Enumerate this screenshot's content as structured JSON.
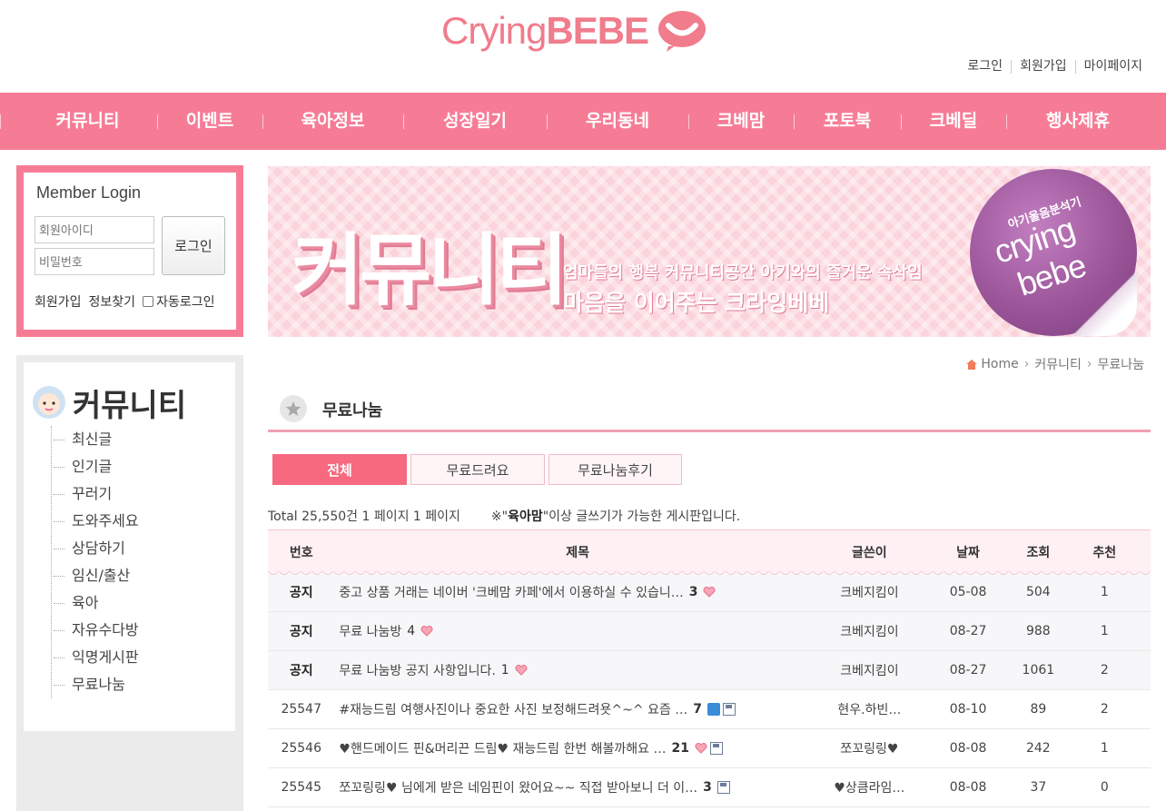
{
  "header": {
    "logo_text_light": "Crying",
    "logo_text_bold": "BEBE",
    "util_links": [
      "로그인",
      "회원가입",
      "마이페이지"
    ]
  },
  "gnb": [
    "커뮤니티",
    "이벤트",
    "육아정보",
    "성장일기",
    "우리동네",
    "크베맘",
    "포토북",
    "크베딜",
    "행사제휴"
  ],
  "login": {
    "title": "Member Login",
    "id_placeholder": "회원아이디",
    "pw_placeholder": "비밀번호",
    "button": "로그인",
    "join": "회원가입",
    "find": "정보찾기",
    "auto": "자동로그인"
  },
  "side": {
    "title": "커뮤니티",
    "items": [
      "최신글",
      "인기글",
      "꾸러기",
      "도와주세요",
      "상담하기",
      "임신/출산",
      "육아",
      "자유수다방",
      "익명게시판",
      "무료나눔"
    ]
  },
  "banner": {
    "title": "커뮤니티",
    "sub1": "엄마들의 행복 커뮤니티공간 아기와의 즐거운 속삭임",
    "sub2": "마음을 이어주는 크라잉베베",
    "sticker_top": "아기울음분석기",
    "sticker_word1": "crying",
    "sticker_word2": "bebe"
  },
  "breadcrumb": [
    "Home",
    "커뮤니티",
    "무료나눔"
  ],
  "page_title": "무료나눔",
  "tabs": [
    "전체",
    "무료드려요",
    "무료나눔후기"
  ],
  "board_info": {
    "total": "Total 25,550건 1 페이지 1 페이지",
    "notice_prefix": "※\"",
    "notice_bold": "육아맘",
    "notice_suffix": "\"이상 글쓰기가 가능한 게시판입니다."
  },
  "table": {
    "headers": [
      "번호",
      "제목",
      "글쓴이",
      "날짜",
      "조회",
      "추천"
    ],
    "rows": [
      {
        "no": "공지",
        "title": "중고 상품 거래는 네이버 '크베맘 카페'에서 이용하실 수 있습니…",
        "count": "3",
        "writer": "크베지킴이",
        "date": "05-08",
        "views": "504",
        "rec": "1"
      },
      {
        "no": "공지",
        "title": "무료 나눔방",
        "count": "4",
        "writer": "크베지킴이",
        "date": "08-27",
        "views": "988",
        "rec": "1"
      },
      {
        "no": "공지",
        "title": "무료 나눔방 공지 사항입니다.",
        "count": "1",
        "writer": "크베지킴이",
        "date": "08-27",
        "views": "1061",
        "rec": "2"
      },
      {
        "no": "25547",
        "title": "#재능드림 여행사진이나 중요한 사진 보정해드려욧^~^ 요즘 …",
        "count": "7",
        "writer": "현우.하빈…",
        "date": "08-10",
        "views": "89",
        "rec": "2"
      },
      {
        "no": "25546",
        "title": "♥핸드메이드 핀&머리끈 드림♥ 재능드림 한번 해볼까해요 …",
        "count": "21",
        "writer": "쪼꼬링링♥",
        "date": "08-08",
        "views": "242",
        "rec": "1"
      },
      {
        "no": "25545",
        "title": "쪼꼬링링♥ 님에게 받은 네임핀이 왔어요~~ 직접 받아보니 더 이…",
        "count": "3",
        "writer": "♥상큼라임…",
        "date": "08-08",
        "views": "37",
        "rec": "0"
      }
    ]
  },
  "colors": {
    "brand_pink": "#f67c96",
    "logo_pink": "#f07c8c",
    "active_tab": "#f7697f"
  }
}
